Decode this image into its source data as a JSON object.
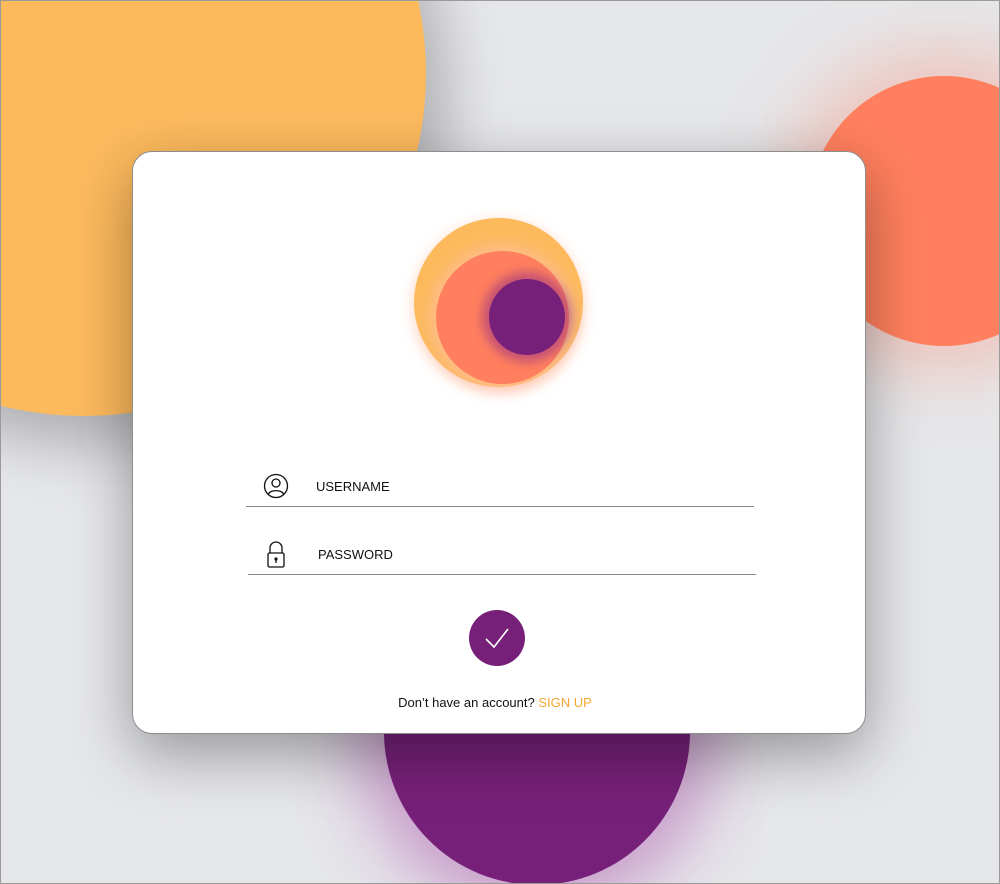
{
  "login": {
    "username_placeholder": "USERNAME",
    "password_placeholder": "PASSWORD",
    "submit_icon": "checkmark-icon",
    "signup_prompt": "Don’t have an account?",
    "signup_link": "SIGN UP"
  },
  "icons": {
    "username": "user-icon",
    "password": "lock-icon"
  },
  "colors": {
    "orange": "#fdba5d",
    "coral": "#ff7f5e",
    "purple": "#772079",
    "link": "#f4a630",
    "background": "#e6e7ea"
  }
}
